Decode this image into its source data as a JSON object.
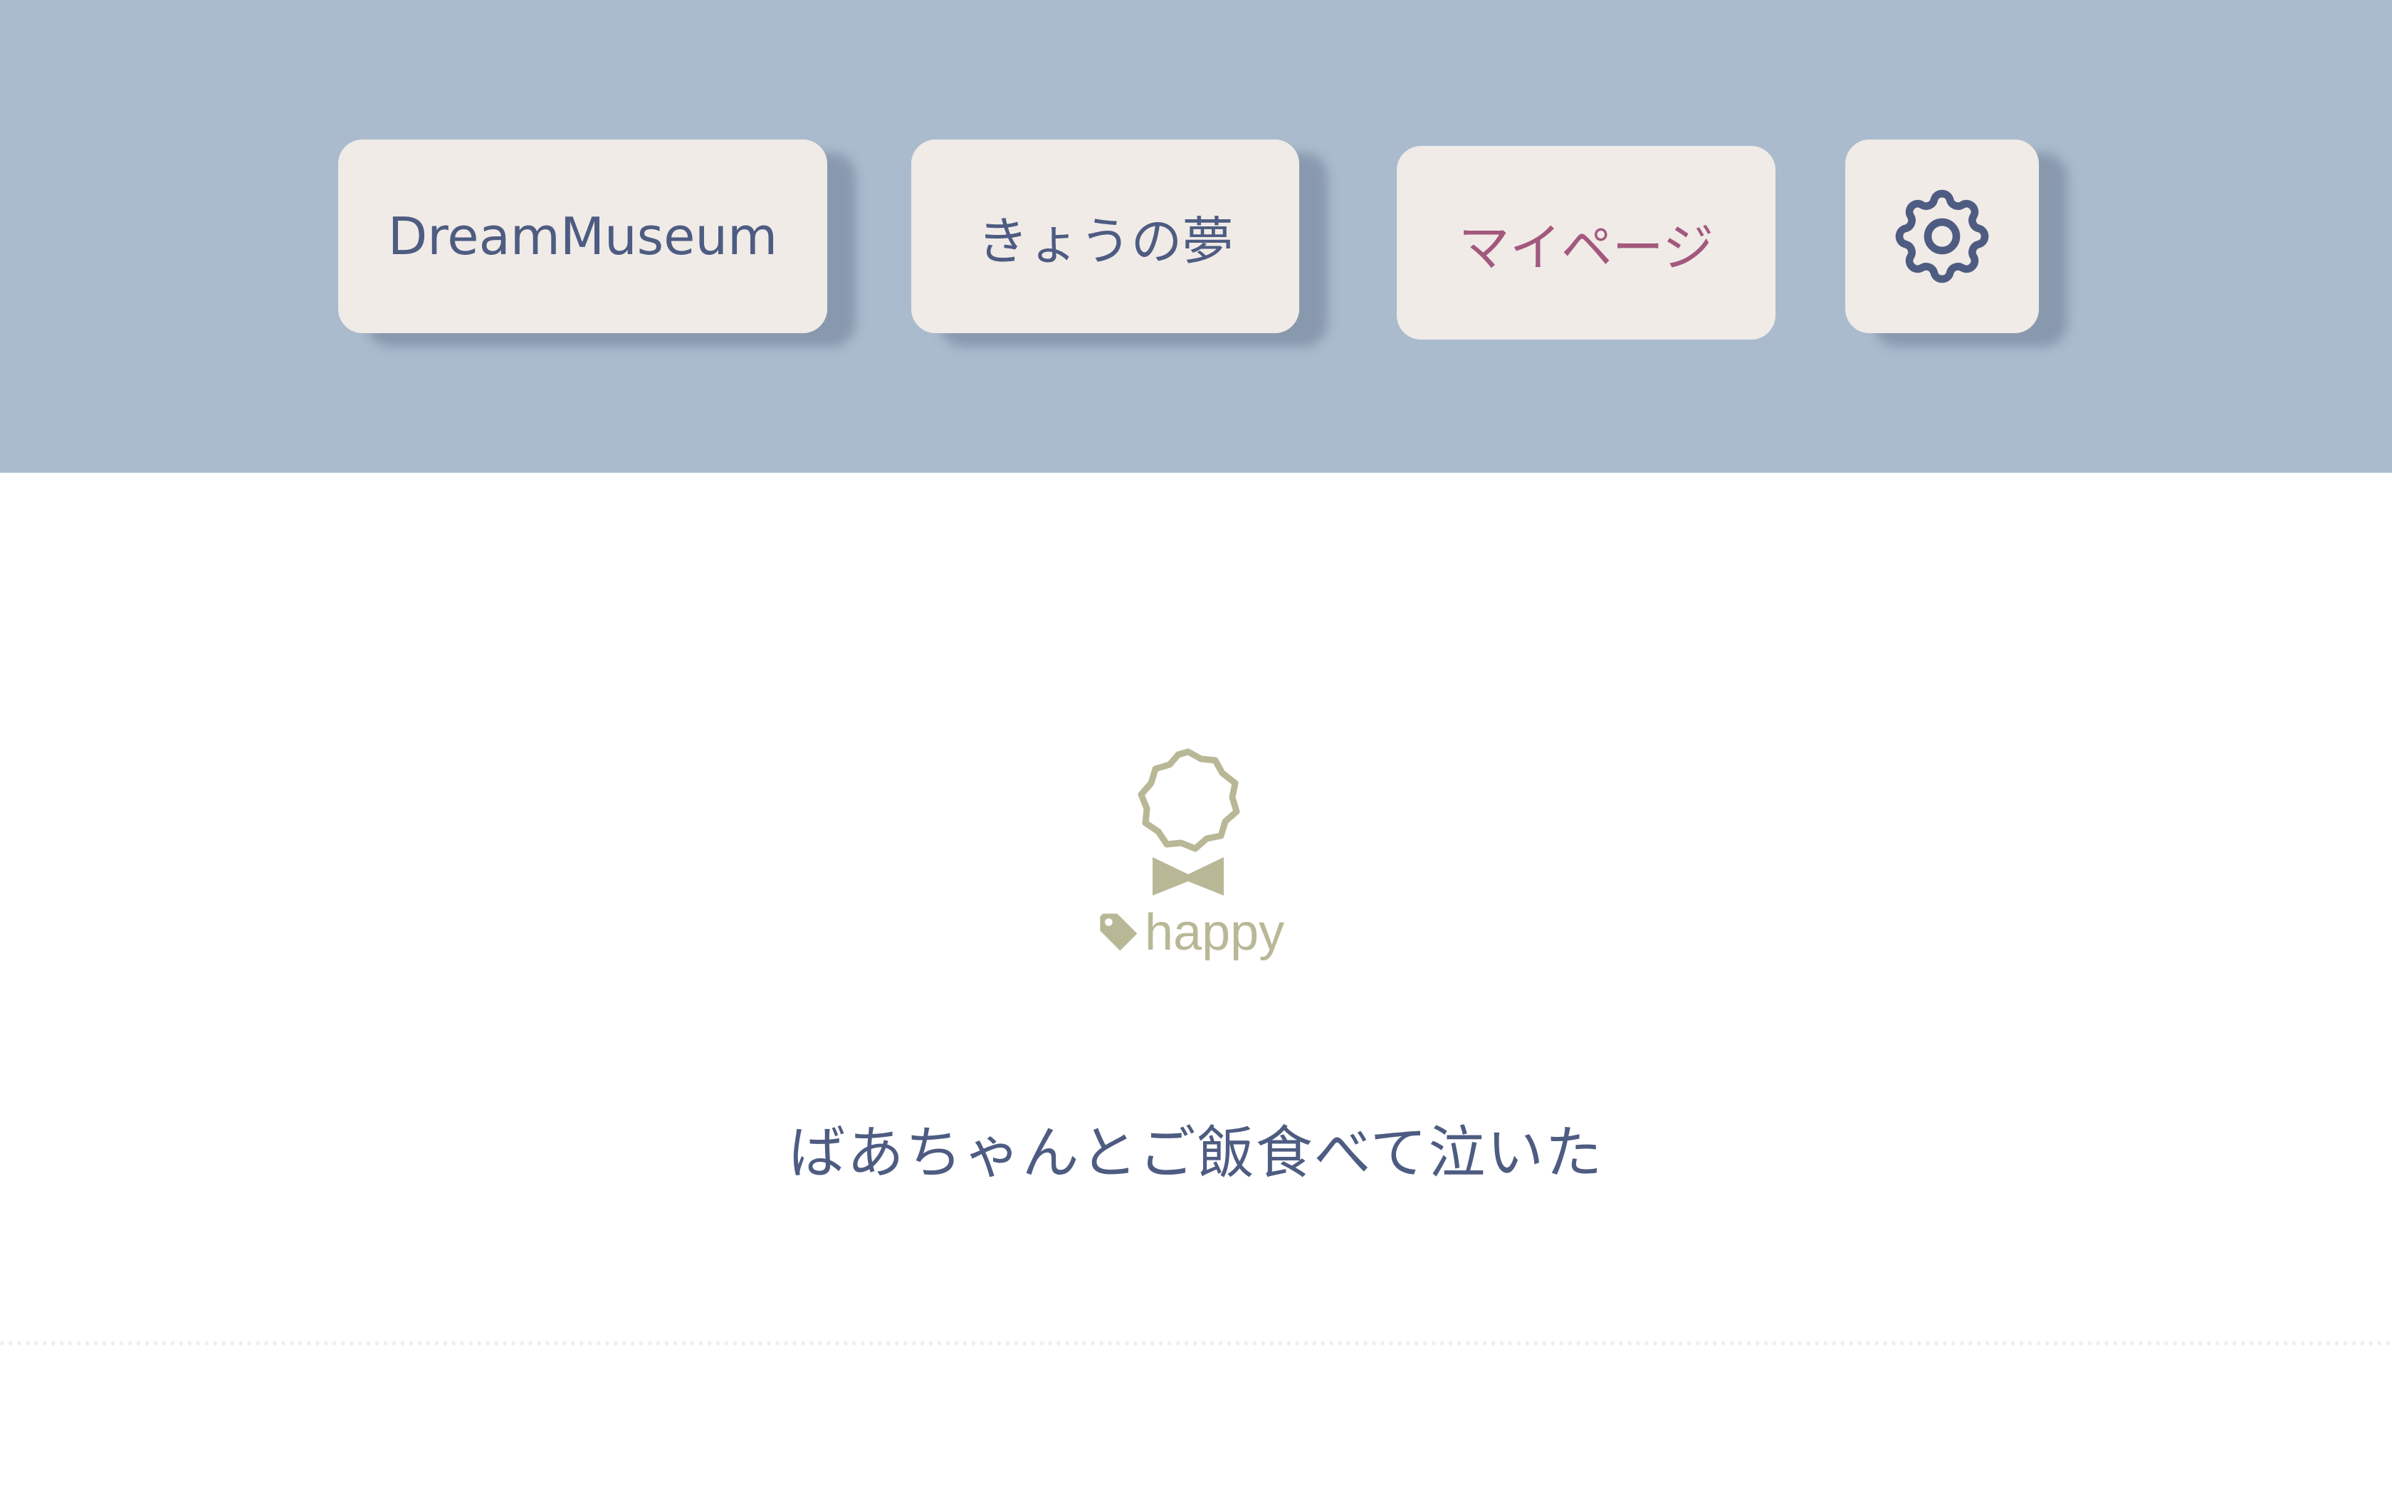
{
  "nav": {
    "home_label": "DreamMuseum",
    "today_label": "きょうの夢",
    "mypage_label": "マイページ",
    "settings_icon": "gear-icon"
  },
  "dream": {
    "badge_icon": "award-badge-icon",
    "tag_icon": "tag-icon",
    "tag_label": "happy",
    "text": "ばあちゃんとご飯食べて泣いた"
  },
  "colors": {
    "header_bg": "#aabbce",
    "button_bg": "#f0ebe7",
    "text_primary": "#4e5c82",
    "mypage_accent": "#a3587d",
    "tag_color": "#b8b897"
  }
}
